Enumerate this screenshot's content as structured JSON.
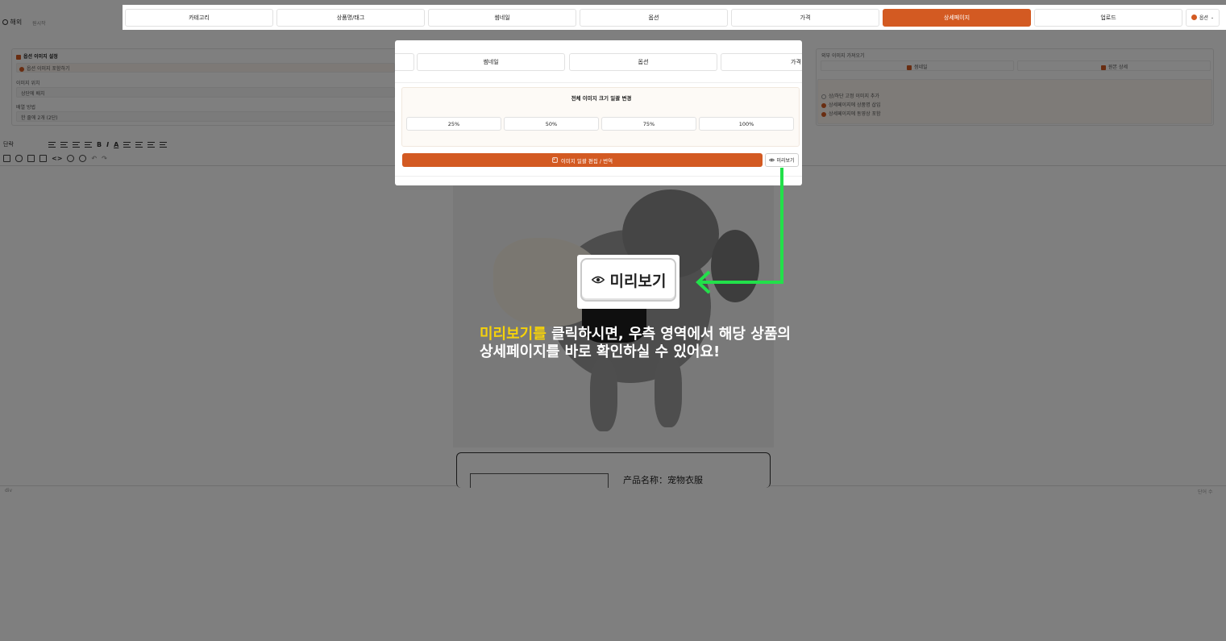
{
  "header": {
    "left_label": "해외",
    "left_sub": "원시작",
    "tabs": [
      "카테고리",
      "상품명/태그",
      "썸네일",
      "옵션",
      "가격",
      "상세페이지",
      "업로드"
    ],
    "active_tab": "상세페이지",
    "option_button": "옵션"
  },
  "background": {
    "option_image_title": "옵션 이미지 설정",
    "option_image_checkbox": "옵션 이미지 포함하기",
    "image_position_label": "이미지 위치",
    "image_position_value": "상단에 배치",
    "arrange_label": "배열 방법",
    "arrange_value": "한 줄에 2개 (2단)",
    "external_title": "외부 이미지 가져오기",
    "external_btn_1": "썸네일",
    "external_btn_2": "원본 상세",
    "opt_1": "상/하단 고정 이미지 추가",
    "opt_2": "상세페이지에 상품명 삽입",
    "opt_3": "상세페이지에 동영상 포함",
    "toolbar_paragraph": "단락",
    "status_left": "div",
    "status_right": "단어 수",
    "card_text": "产品名称：宠物衣服"
  },
  "panel": {
    "tabs": [
      "썸네일",
      "옵션",
      "가격"
    ],
    "resize_title": "전체 이미지 크기 일괄 변경",
    "percent_buttons": [
      "25%",
      "50%",
      "75%",
      "100%"
    ],
    "edit_button": "이미지 일괄 편집 / 번역",
    "preview_button": "미리보기"
  },
  "callout": {
    "zoom_label": "미리보기",
    "highlight": "미리보기를",
    "line1_rest": " 클릭하시면, 우측 영역에서 해당 상품의",
    "line2": "상세페이지를 바로 확인하실 수 있어요!"
  },
  "colors": {
    "accent": "#d35a22",
    "arrow": "#22e04a",
    "highlight": "#f5d20b"
  }
}
